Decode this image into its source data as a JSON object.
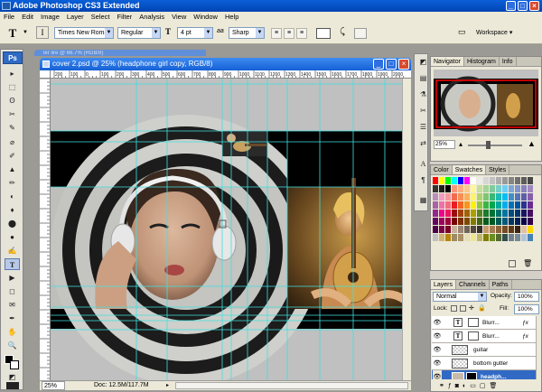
{
  "app": {
    "title": "Adobe Photoshop CS3 Extended"
  },
  "window_buttons": {
    "minimize": "_",
    "maximize": "□",
    "close": "×"
  },
  "menu": [
    "File",
    "Edit",
    "Image",
    "Layer",
    "Select",
    "Filter",
    "Analysis",
    "View",
    "Window",
    "Help"
  ],
  "options_bar": {
    "tool_glyph": "T",
    "font_family": "Times New Roman",
    "font_style": "Regular",
    "font_size": "4 pt",
    "anti_alias_prefix": "aa",
    "anti_alias": "Sharp",
    "workspace_label": "Workspace ▾",
    "dropdown_arrow": "▼"
  },
  "tools": {
    "ps_logo": "Ps",
    "glyphs": [
      "▸",
      "⬚",
      "ʘ",
      "✂",
      "✎",
      "⌀",
      "✐",
      "▲",
      "✏",
      "◐",
      "♦",
      "⬤",
      "●",
      "✍",
      "T",
      "▶",
      "◻",
      "✋",
      "🔍",
      "◩",
      "▣",
      "▭"
    ]
  },
  "document": {
    "background_title": "ler lire @ 66.7% (RGB/8)",
    "title": "cover 2.psd @ 25% (headphone girl copy, RGB/8)",
    "ruler_marks": [
      "200",
      "100",
      "0",
      "100",
      "200",
      "300",
      "400",
      "500",
      "600",
      "700",
      "800",
      "900",
      "1000",
      "1100",
      "1200",
      "1300",
      "1400",
      "1500",
      "1600",
      "1700",
      "1800",
      "1900",
      "2000"
    ],
    "zoom": "25%",
    "doc_size": "Doc: 12.5M/117.7M"
  },
  "right_icons": [
    "◩",
    "▤",
    "⚗",
    "✂",
    "☰",
    "⇄",
    "A",
    "¶",
    "▦"
  ],
  "navigator": {
    "tabs": [
      "Navigator",
      "Histogram",
      "Info"
    ],
    "zoom": "25%"
  },
  "color_panel": {
    "tabs": [
      "Color",
      "Swatches",
      "Styles"
    ]
  },
  "layers_panel": {
    "tabs": [
      "Layers",
      "Channels",
      "Paths"
    ],
    "blend_mode": "Normal",
    "opacity_label": "Opacity:",
    "opacity": "100%",
    "lock_label": "Lock:",
    "fill_label": "Fill:",
    "fill": "100%",
    "layers": [
      {
        "name": "Blurr...",
        "type": "text",
        "selected": false
      },
      {
        "name": "Blurr...",
        "type": "text",
        "selected": false
      },
      {
        "name": "guitar",
        "type": "image",
        "selected": false
      },
      {
        "name": "bottom gutter",
        "type": "image",
        "selected": false
      },
      {
        "name": "headph...",
        "type": "image",
        "selected": true
      }
    ]
  },
  "colors": {
    "xp_blue": "#0a5fd8",
    "selection_blue": "#316ac5",
    "guide_cyan": "#3fe0e0",
    "nav_box_red": "#ff0000"
  }
}
